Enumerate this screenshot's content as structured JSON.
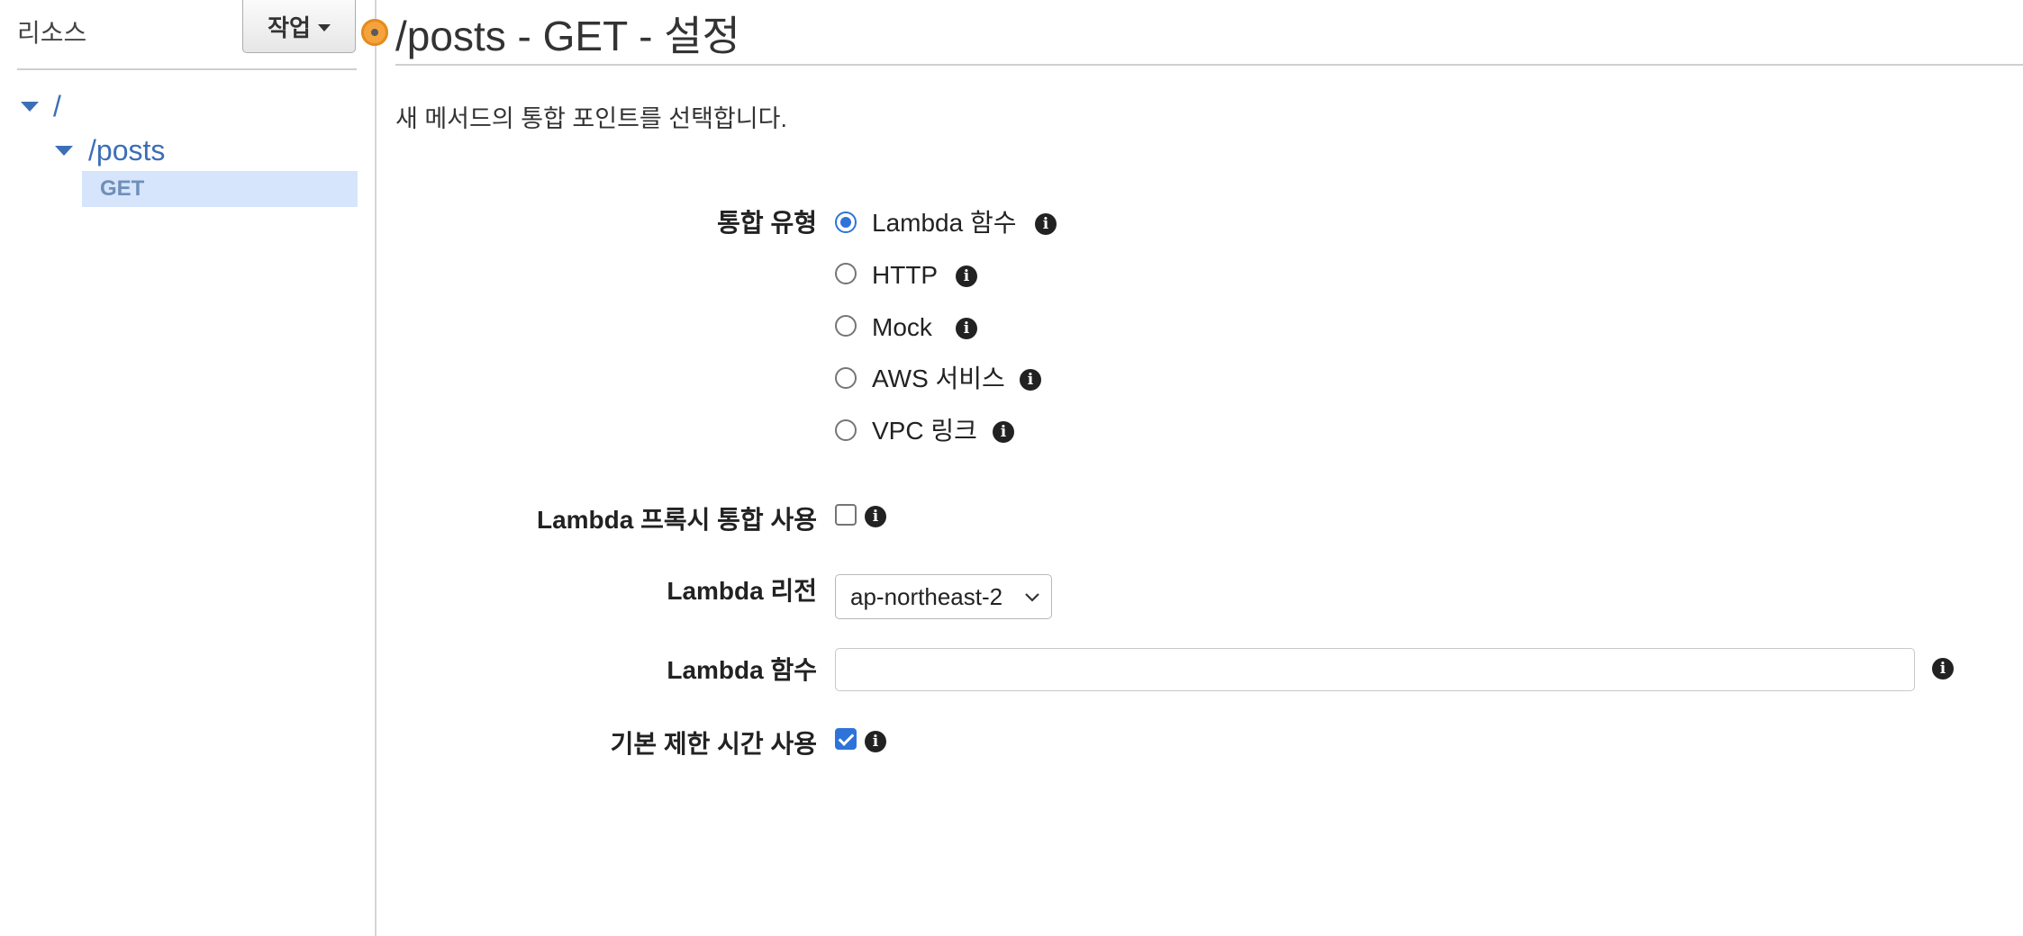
{
  "sidebar": {
    "title": "리소스",
    "action_button": "작업",
    "tree": {
      "root": "/",
      "posts": "/posts",
      "method": "GET"
    }
  },
  "main": {
    "title": "/posts - GET - 설정",
    "description": "새 메서드의 통합 포인트를 선택합니다.",
    "integration_type": {
      "label": "통합 유형",
      "options": [
        {
          "label": "Lambda 함수",
          "selected": true
        },
        {
          "label": "HTTP",
          "selected": false
        },
        {
          "label": "Mock",
          "selected": false
        },
        {
          "label": "AWS 서비스",
          "selected": false
        },
        {
          "label": "VPC 링크",
          "selected": false
        }
      ]
    },
    "proxy": {
      "label": "Lambda 프록시 통합 사용",
      "checked": false
    },
    "region": {
      "label": "Lambda 리전",
      "value": "ap-northeast-2"
    },
    "function": {
      "label": "Lambda 함수",
      "value": ""
    },
    "timeout": {
      "label": "기본 제한 시간 사용",
      "checked": true
    },
    "info_glyph": "i"
  },
  "colors": {
    "accent": "#2e73d9",
    "link": "#3b6fb6",
    "selected_bg": "#d6e5fb",
    "resizer": "#f5a33d"
  }
}
